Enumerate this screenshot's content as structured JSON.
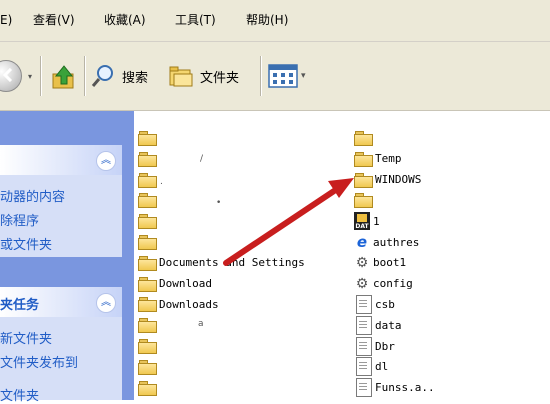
{
  "menu": {
    "items": [
      "E)",
      "查看(V)",
      "收藏(A)",
      "工具(T)",
      "帮助(H)"
    ]
  },
  "toolbar": {
    "search_label": "搜索",
    "folders_label": "文件夹"
  },
  "left_pane": {
    "panel1": {
      "links": [
        "动器的内容",
        "除程序",
        "或文件夹"
      ]
    },
    "panel2": {
      "title": "夹任务",
      "links": [
        "新文件夹",
        "文件夹发布到",
        "文件夹"
      ]
    }
  },
  "files": {
    "col1": [
      {
        "name": "",
        "icon": "folder-icon"
      },
      {
        "name": "",
        "icon": "folder-icon"
      },
      {
        "name": "",
        "icon": "folder-icon"
      },
      {
        "name": "",
        "icon": "folder-icon"
      },
      {
        "name": "",
        "icon": "folder-icon"
      },
      {
        "name": "",
        "icon": "folder-icon"
      },
      {
        "name": "Documents and Settings",
        "icon": "folder-icon"
      },
      {
        "name": "Download",
        "icon": "folder-icon"
      },
      {
        "name": "Downloads",
        "icon": "folder-icon"
      },
      {
        "name": "",
        "icon": "folder-icon"
      },
      {
        "name": "",
        "icon": "folder-icon"
      },
      {
        "name": "",
        "icon": "folder-icon"
      },
      {
        "name": "",
        "icon": "folder-icon"
      }
    ],
    "col2": [
      {
        "name": "",
        "icon": "folder-icon"
      },
      {
        "name": "Temp",
        "icon": "folder-icon"
      },
      {
        "name": "WINDOWS",
        "icon": "folder-icon"
      },
      {
        "name": "",
        "icon": "folder-icon"
      },
      {
        "name": "1",
        "icon": "dat-file-icon"
      },
      {
        "name": "authres",
        "icon": "ie-icon"
      },
      {
        "name": "boot1",
        "icon": "settings-file-icon"
      },
      {
        "name": "config",
        "icon": "settings-file-icon"
      },
      {
        "name": "csb",
        "icon": "text-file-icon"
      },
      {
        "name": "data",
        "icon": "text-file-icon"
      },
      {
        "name": "Dbr",
        "icon": "text-file-icon"
      },
      {
        "name": "dl",
        "icon": "text-file-icon"
      },
      {
        "name": "Funss.a..",
        "icon": "text-file-icon"
      }
    ]
  },
  "annotation": {
    "color": "#c81e1e"
  }
}
